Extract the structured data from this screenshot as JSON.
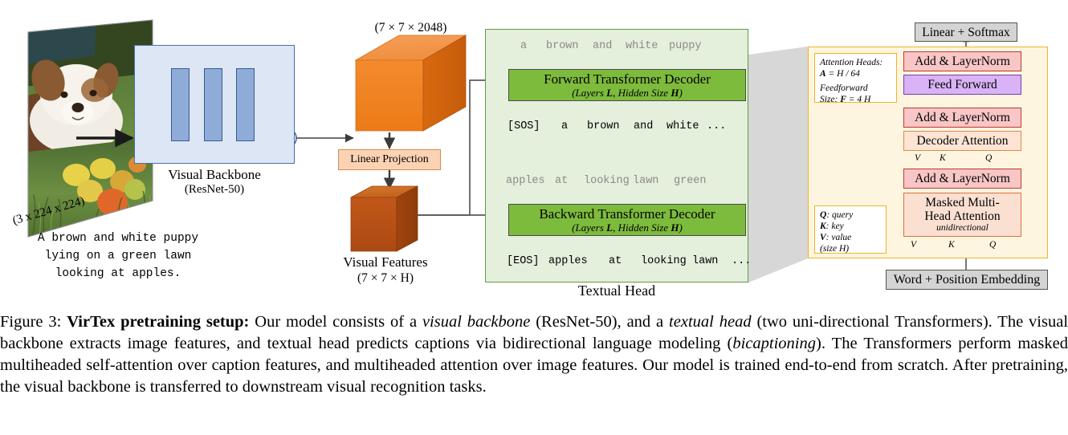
{
  "figure": {
    "number": "Figure 3:",
    "title": "VirTex pretraining setup:",
    "body_1": " Our model consists of a ",
    "em_1": "visual backbone",
    "body_2": " (ResNet-50), and a ",
    "em_2": "textual head",
    "body_3": " (two uni-directional Transformers). The visual backbone extracts image features, and textual head predicts captions via bidirectional language modeling (",
    "em_3": "bicaptioning",
    "body_4": "). The Transformers perform masked multiheaded self-attention over caption features, and multiheaded attention over image features.  Our model is trained end-to-end from scratch.  After pretraining, the visual backbone is transferred to downstream visual recognition tasks."
  },
  "input_image": {
    "dims_label": "(3 x 224 x 224)",
    "caption_line_1": "A brown and white puppy",
    "caption_line_2": "lying on a green lawn",
    "caption_line_3": "looking at apples."
  },
  "visual_backbone": {
    "title": "Visual Backbone",
    "subtitle": "(ResNet-50)",
    "block_count": 3,
    "sum_symbol": "+"
  },
  "feature_cube": {
    "dims_label": "(7 × 7 × 2048)"
  },
  "linear_projection": {
    "label": "Linear Projection"
  },
  "visual_features": {
    "title": "Visual Features",
    "dims_label": "(7 × 7 × H)"
  },
  "textual_head": {
    "title": "Textual Head",
    "forward": {
      "title": "Forward Transformer Decoder",
      "subtitle": "(Layers L, Hidden Size H)",
      "outputs": [
        "a",
        "brown",
        "and",
        "white",
        "puppy"
      ],
      "inputs": [
        "[SOS]",
        "a",
        "brown",
        "and",
        "white",
        "..."
      ]
    },
    "backward": {
      "title": "Backward Transformer Decoder",
      "subtitle": "(Layers L, Hidden Size H)",
      "outputs": [
        "apples",
        "at",
        "looking",
        "lawn",
        "green"
      ],
      "inputs": [
        "[EOS]",
        "apples",
        "at",
        "looking",
        "lawn",
        "..."
      ]
    }
  },
  "detail_panel": {
    "linear_softmax": "Linear + Softmax",
    "add_layernorm_top": "Add & LayerNorm",
    "feed_forward": "Feed Forward",
    "add_layernorm_mid": "Add & LayerNorm",
    "decoder_attention": "Decoder Attention",
    "add_layernorm_bottom": "Add & LayerNorm",
    "masked_attention_line1": "Masked Multi-",
    "masked_attention_line2": "Head Attention",
    "masked_attention_sub": "unidirectional",
    "word_position_embedding": "Word + Position Embedding",
    "note_heads": {
      "line1": "Attention Heads:",
      "line2_bold": "A",
      "line2_rest": " = H / 64",
      "line3": "Feedforward",
      "line4_pre": "Size: ",
      "line4_bold": "F",
      "line4_rest": " = 4 H"
    },
    "note_qkv": {
      "line1_bold": "Q",
      "line1_rest": ": query",
      "line2_bold": "K",
      "line2_rest": ": key",
      "line3_bold": "V",
      "line3_rest": ": value",
      "line4": "(size H)"
    },
    "qkv_labels": {
      "v": "V",
      "k": "K",
      "q": "Q"
    }
  },
  "colors": {
    "backbone_fill": "#dce6f5",
    "backbone_stroke": "#4a6fa8",
    "backbone_block": "#8fabd8",
    "cube_orange": "#f07f22",
    "cube_darkorange": "#c2571a",
    "textual_head_fill": "#e4efdc",
    "textual_head_stroke": "#5e9c3f",
    "decoder_green": "#7dbb3c",
    "panel_fill": "#fdf5e0",
    "panel_stroke": "#f0b323",
    "add_norm_red": "#f8c6c6",
    "feed_forward_purple": "#d9b3f5",
    "gray_box": "#d4d4d4",
    "connector_gray": "#d0d0d0"
  }
}
